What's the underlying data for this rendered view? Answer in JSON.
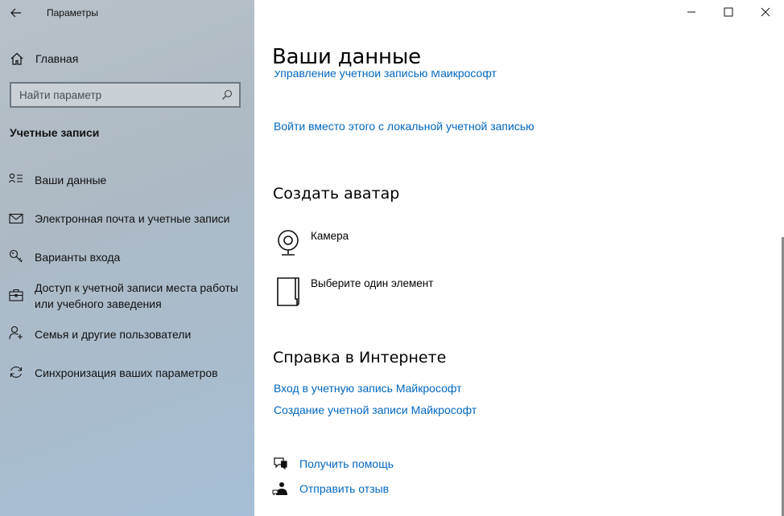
{
  "window": {
    "title": "Параметры"
  },
  "sidebar": {
    "home_label": "Главная",
    "search_placeholder": "Найти параметр",
    "section_title": "Учетные записи",
    "items": [
      {
        "label": "Ваши данные",
        "icon": "person-list-icon"
      },
      {
        "label": "Электронная почта и учетные записи",
        "icon": "mail-icon"
      },
      {
        "label": "Варианты входа",
        "icon": "key-icon"
      },
      {
        "label": "Доступ к учетной записи места работы или учебного заведения",
        "icon": "briefcase-icon"
      },
      {
        "label": "Семья и другие пользователи",
        "icon": "person-add-icon"
      },
      {
        "label": "Синхронизация ваших параметров",
        "icon": "sync-icon"
      }
    ]
  },
  "main": {
    "title": "Ваши данные",
    "manage_link": "Управление учетной записью Майкрософт",
    "local_link": "Войти вместо этого с локальной учетной записью",
    "avatar_heading": "Создать аватар",
    "camera_label": "Камера",
    "browse_label": "Выберите один элемент",
    "help_heading": "Справка в Интернете",
    "help_links": [
      "Вход в учетную запись Майкрософт",
      "Создание учетной записи Майкрософт"
    ],
    "get_help": "Получить помощь",
    "feedback": "Отправить отзыв"
  },
  "colors": {
    "accent": "#0067c0",
    "sidebar_bg": "#aebac4"
  }
}
